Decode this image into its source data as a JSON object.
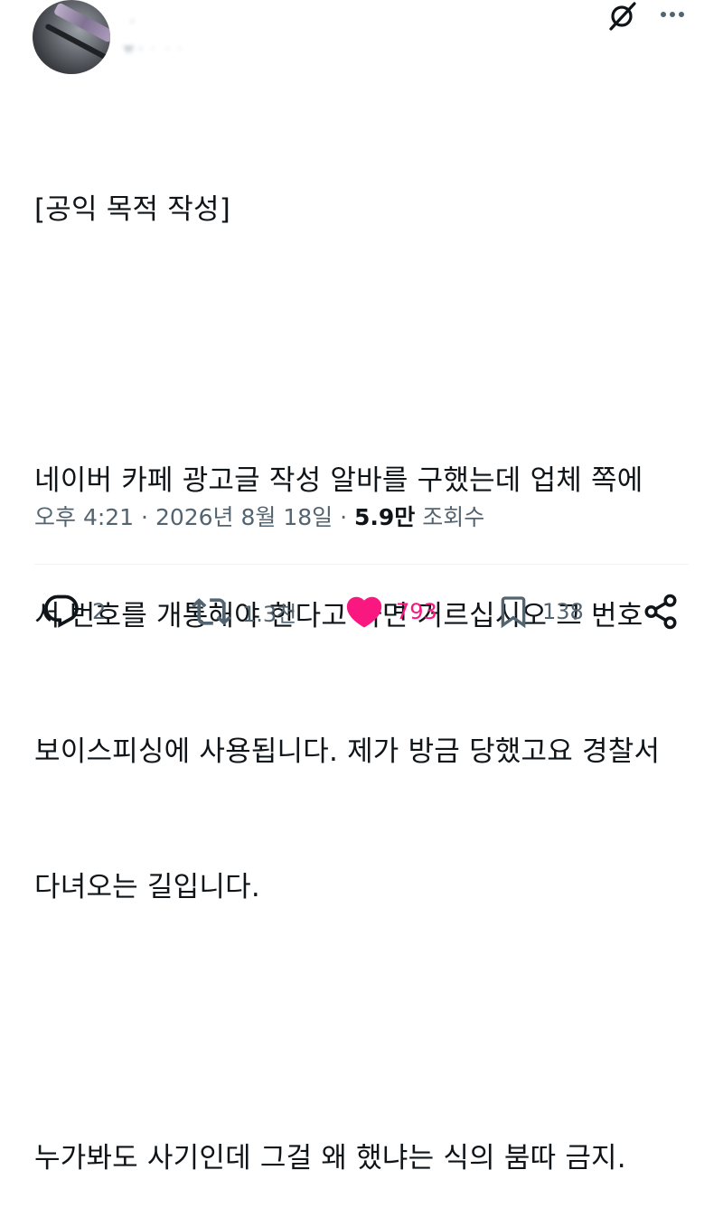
{
  "header": {
    "display_name": "ᆞ                ",
    "handle": "  ㅠ  ·  ᆞ ᆞᆞ  "
  },
  "tweet": {
    "lines": [
      "[공익 목적 작성]",
      "",
      "네이버 카페 광고글 작성 알바를 구했는데 업체 쪽에",
      "서 번호를 개통해야 한다고 하면 거르십시오 그 번호",
      "보이스피싱에 사용됩니다. 제가 방금 당했고요 경찰서",
      "다녀오는 길입니다.",
      "",
      "누가봐도 사기인데 그걸 왜 했냐는 식의 붐따 금지."
    ]
  },
  "meta": {
    "time": "오후 4:21",
    "separator": " · ",
    "date": "2026년 8월 18일",
    "separator2": " · ",
    "views_count": "5.9만",
    "views_label": " 조회수"
  },
  "actions": {
    "reply_count": "2",
    "retweet_count": "1.3천",
    "like_count": "793",
    "bookmark_count": "138"
  },
  "colors": {
    "text_primary": "#0f1419",
    "text_secondary": "#536471",
    "like_pink": "#f91880",
    "divider": "#eff3f4"
  },
  "icons": [
    "grok-icon",
    "more-icon",
    "reply-icon",
    "retweet-icon",
    "like-heart-icon",
    "bookmark-icon",
    "share-icon"
  ]
}
